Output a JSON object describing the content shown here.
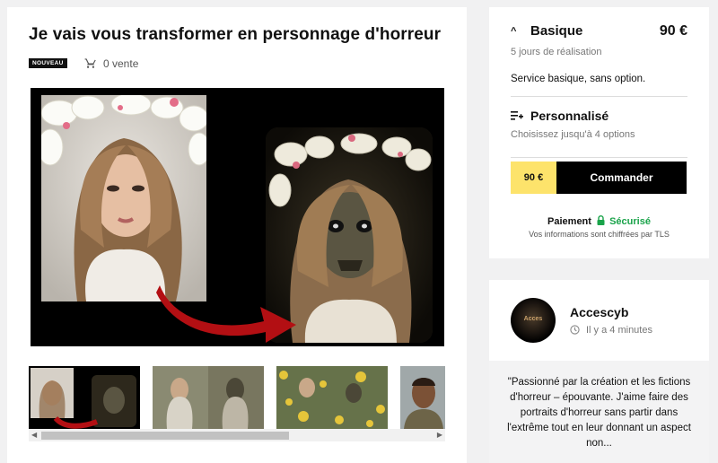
{
  "gig": {
    "title": "Je vais vous transformer en personnage d'horreur",
    "badge": "NOUVEAU",
    "sales": "0 vente"
  },
  "packages": {
    "basic": {
      "title": "Basique",
      "price": "90 €",
      "delay": "5 jours de réalisation",
      "description": "Service basique, sans option."
    },
    "custom": {
      "title": "Personnalisé",
      "subtitle": "Choisissez jusqu'à 4 options"
    }
  },
  "order": {
    "price": "90 €",
    "button_label": "Commander"
  },
  "payment": {
    "label": "Paiement",
    "secure": "Sécurisé",
    "tls_note": "Vos informations sont chiffrées par TLS"
  },
  "seller": {
    "name": "Accescyb",
    "last_seen": "Il y a 4 minutes",
    "avatar_text": "Acces",
    "bio": "\"Passionné par la création et les fictions d'horreur – épouvante. J'aime faire des portraits d'horreur sans partir dans l'extrême tout en leur donnant un aspect non..."
  },
  "gallery": {
    "thumbnail_count": 4,
    "selected_index": 0
  },
  "colors": {
    "accent_yellow": "#fde36b",
    "secure_green": "#1aa34a"
  },
  "icons": [
    "cart-icon",
    "chevron-up-icon",
    "playlist-add-icon",
    "lock-icon",
    "clock-icon"
  ]
}
